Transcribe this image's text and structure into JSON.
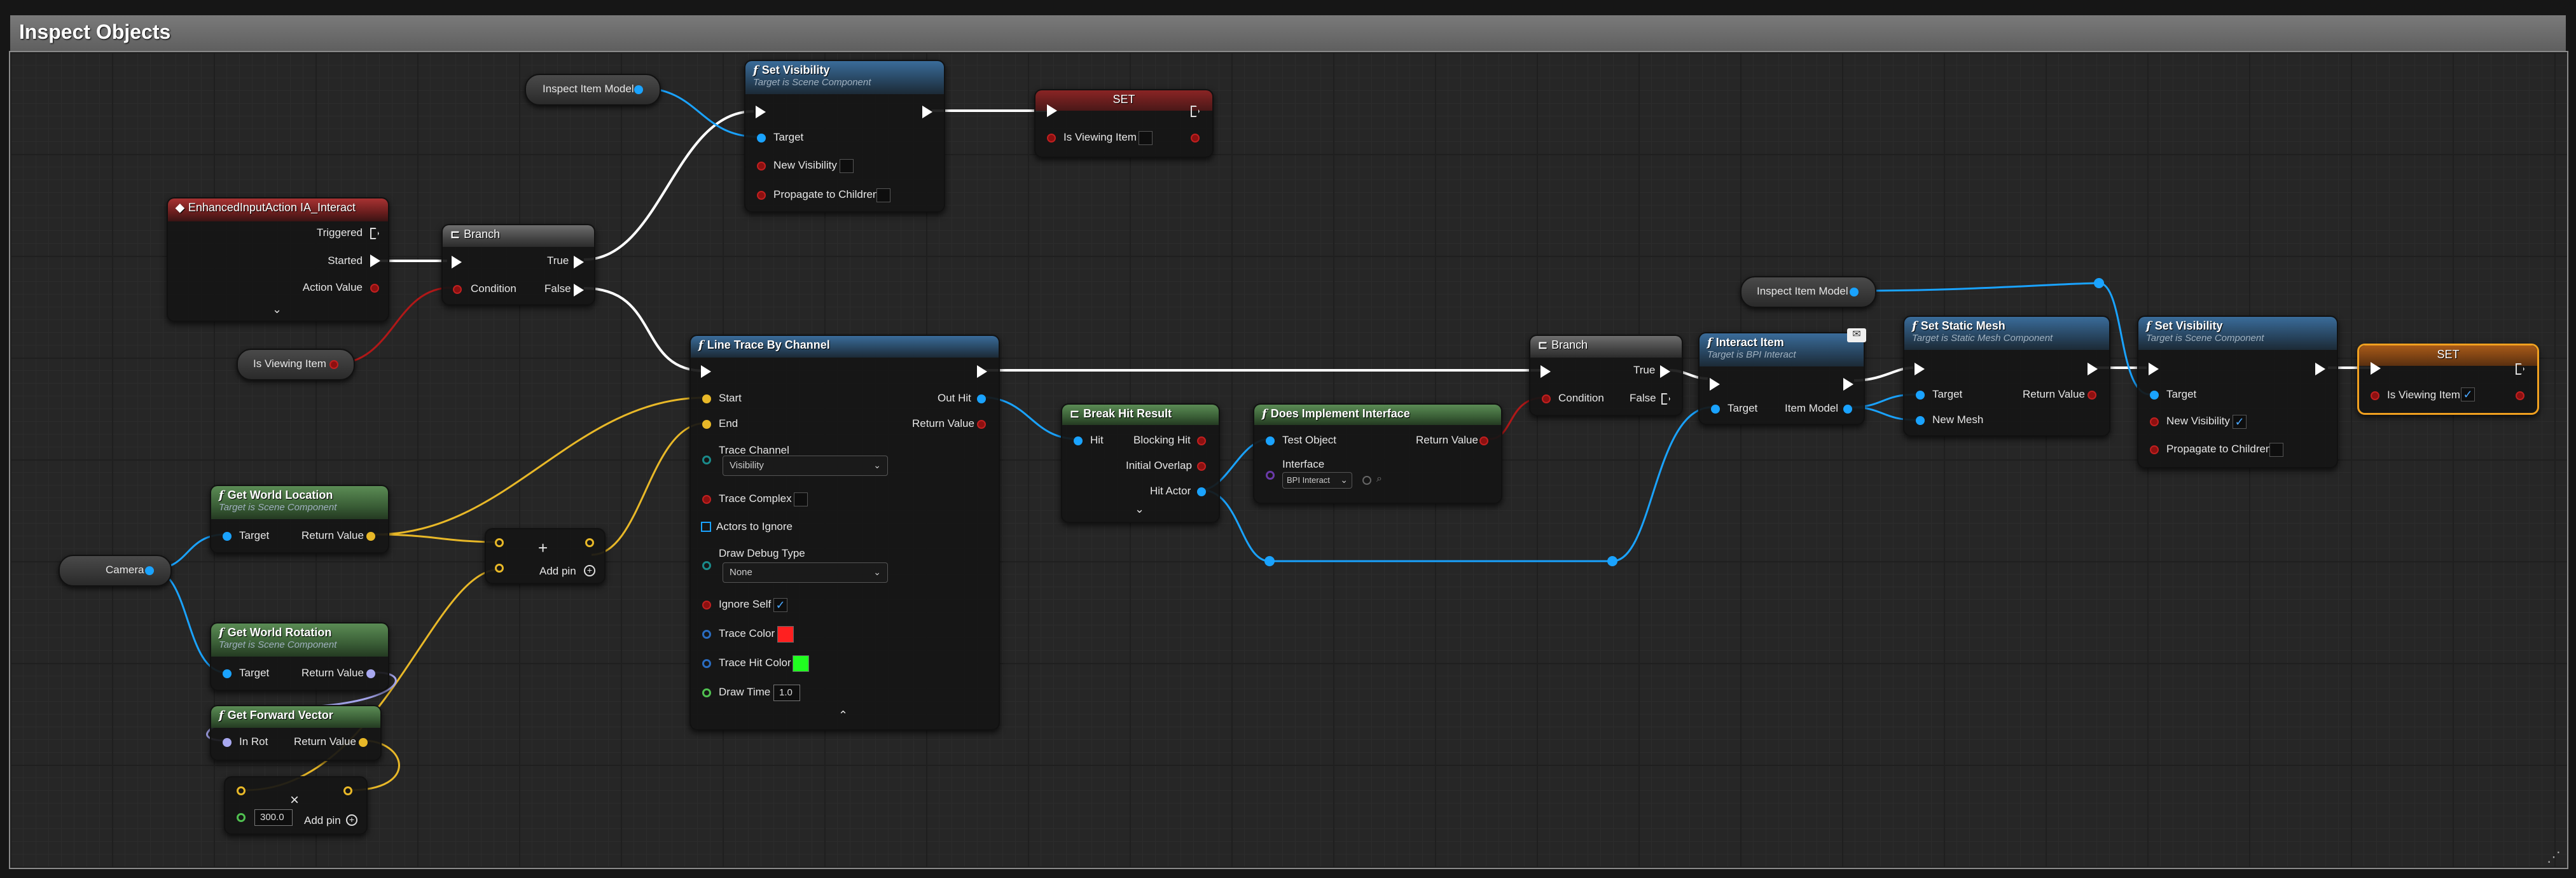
{
  "graph_title": "Inspect Objects",
  "colors": {
    "exec": "#ffffff",
    "object": "#1aa3ff",
    "bool": "#8c1010",
    "vector": "#e8b828",
    "rotator": "#a8a8f0",
    "float": "#7ed24a",
    "trace_color": "#ff2020",
    "trace_hit_color": "#20ff20"
  },
  "icons": {
    "function": "f-function-icon",
    "branch": "branch-icon",
    "event": "event-icon",
    "message": "envelope-icon"
  },
  "variables": {
    "inspect_item_model_1": "Inspect Item Model",
    "inspect_item_model_2": "Inspect Item Model",
    "is_viewing_item": "Is Viewing Item",
    "camera": "Camera"
  },
  "set_visibility_1": {
    "title": "Set Visibility",
    "subtitle": "Target is Scene Component",
    "target": "Target",
    "new_visibility": "New Visibility",
    "propagate": "Propagate to Children"
  },
  "set_1": {
    "title": "SET",
    "var": "Is Viewing Item"
  },
  "event": {
    "title": "EnhancedInputAction IA_Interact",
    "triggered": "Triggered",
    "started": "Started",
    "action_value": "Action Value"
  },
  "branch_1": {
    "title": "Branch",
    "true": "True",
    "false": "False",
    "condition": "Condition"
  },
  "line_trace": {
    "title": "Line Trace By Channel",
    "start": "Start",
    "end": "End",
    "out_hit": "Out Hit",
    "return_value": "Return Value",
    "trace_channel": "Trace Channel",
    "trace_channel_value": "Visibility",
    "trace_complex": "Trace Complex",
    "actors_to_ignore": "Actors to Ignore",
    "draw_debug_type": "Draw Debug Type",
    "draw_debug_value": "None",
    "ignore_self": "Ignore Self",
    "trace_color": "Trace Color",
    "trace_hit_color": "Trace Hit Color",
    "draw_time": "Draw Time",
    "draw_time_value": "1.0"
  },
  "get_world_location": {
    "title": "Get World Location",
    "subtitle": "Target is Scene Component",
    "target": "Target",
    "return_value": "Return Value"
  },
  "get_world_rotation": {
    "title": "Get World Rotation",
    "subtitle": "Target is Scene Component",
    "target": "Target",
    "return_value": "Return Value"
  },
  "get_forward_vector": {
    "title": "Get Forward Vector",
    "in_rot": "In Rot",
    "return_value": "Return Value"
  },
  "add_node": {
    "symbol": "+",
    "add_pin": "Add pin"
  },
  "multiply_node": {
    "symbol": "×",
    "value": "300.0",
    "add_pin": "Add pin"
  },
  "break_hit": {
    "title": "Break Hit Result",
    "hit": "Hit",
    "blocking_hit": "Blocking Hit",
    "initial_overlap": "Initial Overlap",
    "hit_actor": "Hit Actor"
  },
  "does_implement": {
    "title": "Does Implement Interface",
    "test_object": "Test Object",
    "return_value": "Return Value",
    "interface": "Interface",
    "interface_value": "BPI Interact"
  },
  "branch_2": {
    "title": "Branch",
    "true": "True",
    "false": "False",
    "condition": "Condition"
  },
  "interact_item": {
    "title": "Interact Item",
    "subtitle": "Target is BPI Interact",
    "target": "Target",
    "item_model": "Item Model"
  },
  "set_static_mesh": {
    "title": "Set Static Mesh",
    "subtitle": "Target is Static Mesh Component",
    "target": "Target",
    "return_value": "Return Value",
    "new_mesh": "New Mesh"
  },
  "set_visibility_2": {
    "title": "Set Visibility",
    "subtitle": "Target is Scene Component",
    "target": "Target",
    "new_visibility": "New Visibility",
    "propagate": "Propagate to Children"
  },
  "set_2": {
    "title": "SET",
    "var": "Is Viewing Item"
  }
}
